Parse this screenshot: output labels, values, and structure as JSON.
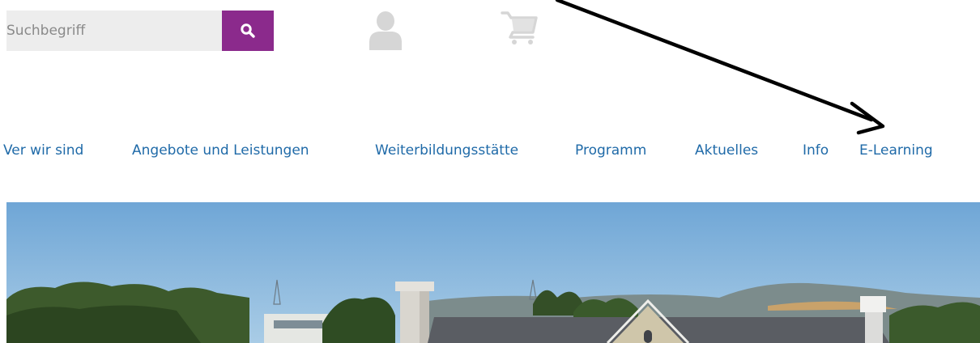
{
  "search": {
    "placeholder": "Suchbegriff",
    "button_icon": "search-icon"
  },
  "header_icons": {
    "account_icon": "user-icon",
    "cart_icon": "cart-icon"
  },
  "nav": {
    "items": [
      {
        "label": "Ver wir sind"
      },
      {
        "label": "Angebote und Leistungen"
      },
      {
        "label": "Weiterbildungsstätte"
      },
      {
        "label": "Programm"
      },
      {
        "label": "Aktuelles"
      },
      {
        "label": "Info"
      },
      {
        "label": "E-Learning"
      }
    ]
  },
  "colors": {
    "accent": "#8b2a8c",
    "nav_link": "#1f6aa8",
    "search_bg": "#ededed",
    "icon_grey": "#d6d6d6",
    "sky": "#8ab7dc"
  },
  "annotation": {
    "type": "arrow",
    "points_to": "E-Learning"
  }
}
